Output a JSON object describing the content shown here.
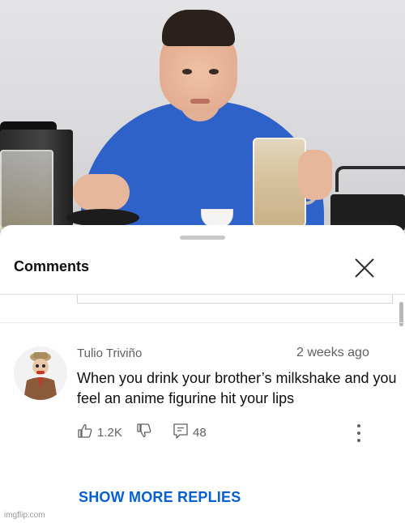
{
  "video": {
    "description_icon": "video-frame-image"
  },
  "sheet": {
    "title": "Comments",
    "close_icon": "close-icon"
  },
  "comment": {
    "author": "Tulio Triviño",
    "timestamp": "2 weeks ago",
    "text": "When you drink your brother’s milkshake and you feel an anime figurine hit your lips",
    "likes": "1.2K",
    "replies": "48",
    "like_icon": "thumbs-up-icon",
    "dislike_icon": "thumbs-down-icon",
    "reply_icon": "reply-icon",
    "more_icon": "kebab-menu-icon"
  },
  "show_more_replies": "SHOW MORE REPLIES",
  "watermark": "imgflip.com",
  "colors": {
    "link_blue": "#065fd4",
    "meta_gray": "#606060",
    "text_black": "#0f0f0f",
    "shirt_blue": "#2f62c8"
  }
}
